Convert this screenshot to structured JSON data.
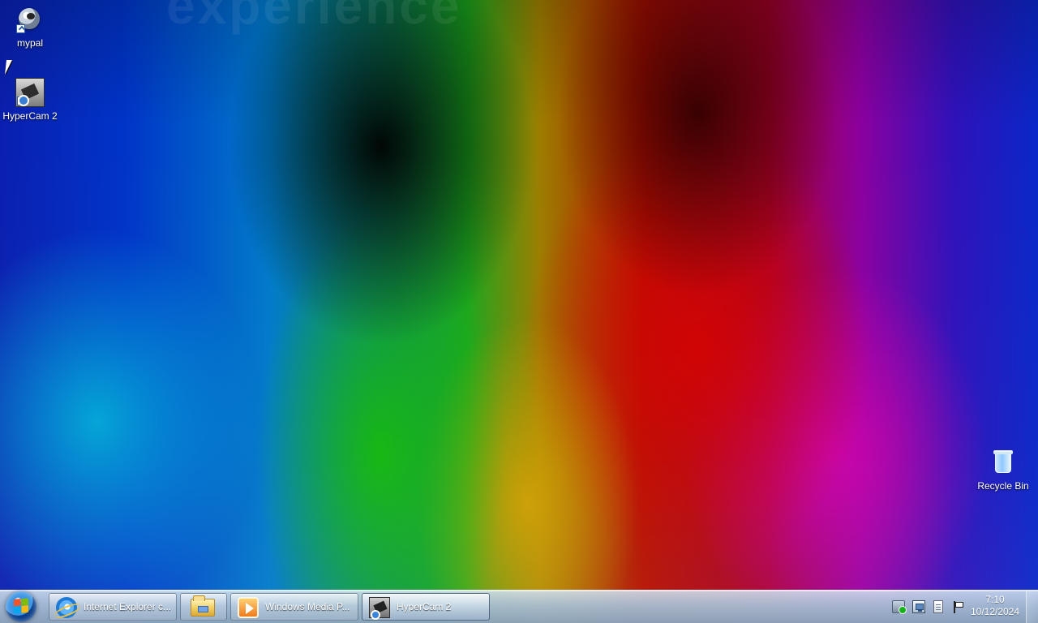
{
  "desktop": {
    "watermark": "experience",
    "icons": [
      {
        "label": "mypal",
        "icon": "mypal-icon"
      },
      {
        "label": "HyperCam 2",
        "icon": "hypercam-icon"
      },
      {
        "label": "Recycle Bin",
        "icon": "recycle-bin-icon"
      }
    ]
  },
  "taskbar": {
    "buttons": [
      {
        "label": "Internet Explorer c...",
        "icon": "internet-explorer-icon"
      },
      {
        "label": "",
        "icon": "folder-icon"
      },
      {
        "label": "Windows Media P...",
        "icon": "windows-media-player-icon"
      },
      {
        "label": "HyperCam 2",
        "icon": "hypercam-icon"
      }
    ],
    "tray": {
      "icons": [
        "security-icon",
        "network-icon",
        "document-icon",
        "flag-icon"
      ],
      "time": "7:10",
      "date": "10/12/2024"
    }
  }
}
